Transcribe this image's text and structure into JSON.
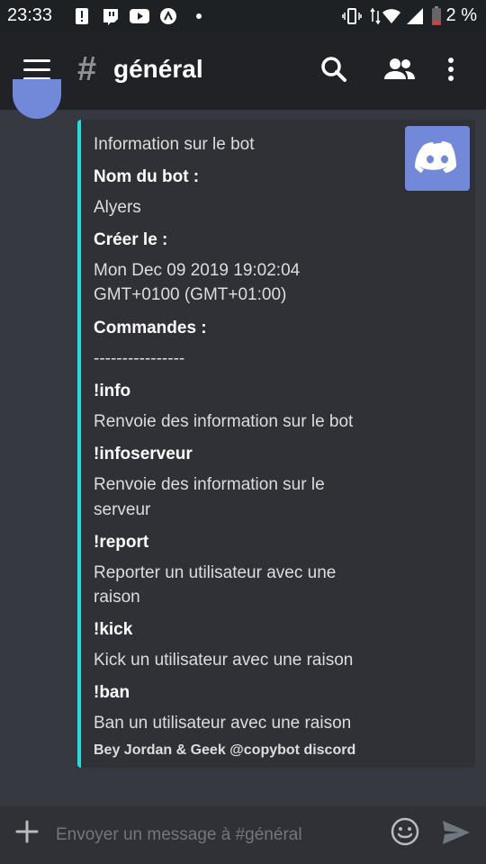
{
  "status_bar": {
    "time": "23:33",
    "battery": "2 %",
    "icons": [
      "alert-icon",
      "twitch-icon",
      "youtube-icon",
      "app-icon",
      "dot-icon",
      "vibrate-icon",
      "data-arrows-icon",
      "wifi-icon",
      "signal-icon",
      "battery-icon"
    ]
  },
  "appbar": {
    "hash": "#",
    "channel": "général",
    "icons": [
      "menu-icon",
      "search-icon",
      "members-icon",
      "more-vert-icon"
    ]
  },
  "embed": {
    "accent_color": "#1ee1de",
    "title": "Information sur le bot",
    "bot_name_label": "Nom du bot :",
    "bot_name": "Alyers",
    "created_label": "Créer le :",
    "created_line1": "Mon Dec 09 2019 19:02:04",
    "created_line2": "GMT+0100 (GMT+01:00)",
    "commands_label": "Commandes :",
    "separator": "----------------",
    "commands": [
      {
        "name": "!info",
        "desc": [
          "Renvoie des information sur le bot"
        ]
      },
      {
        "name": "!infoserveur",
        "desc": [
          "Renvoie des information sur le",
          "serveur"
        ]
      },
      {
        "name": "!report",
        "desc": [
          "Reporter un utilisateur avec une",
          "raison"
        ]
      },
      {
        "name": "!kick",
        "desc": [
          "Kick un utilisateur avec une raison"
        ]
      },
      {
        "name": "!ban",
        "desc": [
          "Ban un utilisateur avec une raison"
        ]
      }
    ],
    "footer": "Bey Jordan & Geek @copybot discord",
    "thumbnail_icon": "discord-logo-icon"
  },
  "composer": {
    "placeholder": "Envoyer un message à #général",
    "icons": [
      "plus-icon",
      "emoji-icon",
      "send-icon"
    ]
  },
  "colors": {
    "background": "#36393f",
    "appbar": "#202225",
    "embed_bg": "#2f3136",
    "blurple": "#7289da"
  }
}
